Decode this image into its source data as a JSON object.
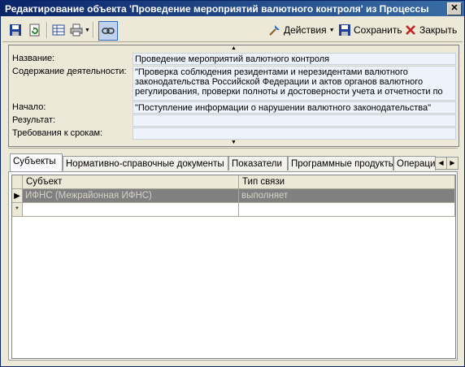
{
  "window": {
    "title": "Редактирование объекта 'Проведение мероприятий валютного контроля' из Процессы",
    "close_glyph": "✕"
  },
  "toolbar": {
    "actions_label": "Действия",
    "save_label": "Сохранить",
    "close_label": "Закрыть"
  },
  "fields": [
    {
      "label": "Название:",
      "value": "Проведение мероприятий валютного контроля"
    },
    {
      "label": "Содержание деятельности:",
      "value": "\"Проверка соблюдения резидентами и нерезидентами валютного законодательства Российской Федерации и актов органов валютного регулирования, проверки полноты и достоверности учета и отчетности по"
    },
    {
      "label": "Начало:",
      "value": "\"Поступление информации о нарушении валютного законодательства\""
    },
    {
      "label": "Результат:",
      "value": ""
    },
    {
      "label": "Требования к срокам:",
      "value": ""
    }
  ],
  "tabs": [
    "Субъекты",
    "Нормативно-справочные документы",
    "Показатели",
    "Программные продукты",
    "Операции"
  ],
  "grid": {
    "columns": [
      "Субъект",
      "Тип связи"
    ],
    "rows": [
      {
        "indicator": "▶",
        "cells": [
          "ИФНС (Межрайонная ИФНС)",
          "выполняет"
        ]
      },
      {
        "indicator": "*",
        "cells": [
          "",
          ""
        ]
      }
    ]
  },
  "icons": {
    "save": "floppy-icon",
    "refresh": "refresh-doc-icon",
    "table": "table-icon",
    "print": "printer-icon",
    "link": "link-icon"
  }
}
